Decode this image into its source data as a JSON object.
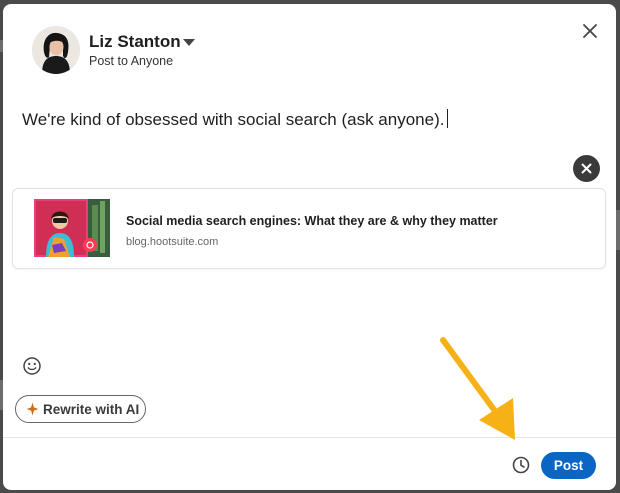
{
  "author": {
    "name": "Liz Stanton",
    "audience": "Post to Anyone",
    "avatar_icon": "user-avatar-photo",
    "dropdown_icon": "caret-down-icon"
  },
  "composer": {
    "text": "We're kind of obsessed with social search (ask anyone)."
  },
  "link_preview": {
    "title": "Social media search engines: What they are & why they matter",
    "domain": "blog.hootsuite.com"
  },
  "toolbar": {
    "rewrite_label": "Rewrite with AI",
    "post_label": "Post",
    "schedule_icon": "clock-icon",
    "emoji_icon": "smiley-icon"
  },
  "colors": {
    "post_button": "#0a66c2",
    "annotation_arrow": "#f6b117",
    "ai_spark": "#c96f1f"
  }
}
